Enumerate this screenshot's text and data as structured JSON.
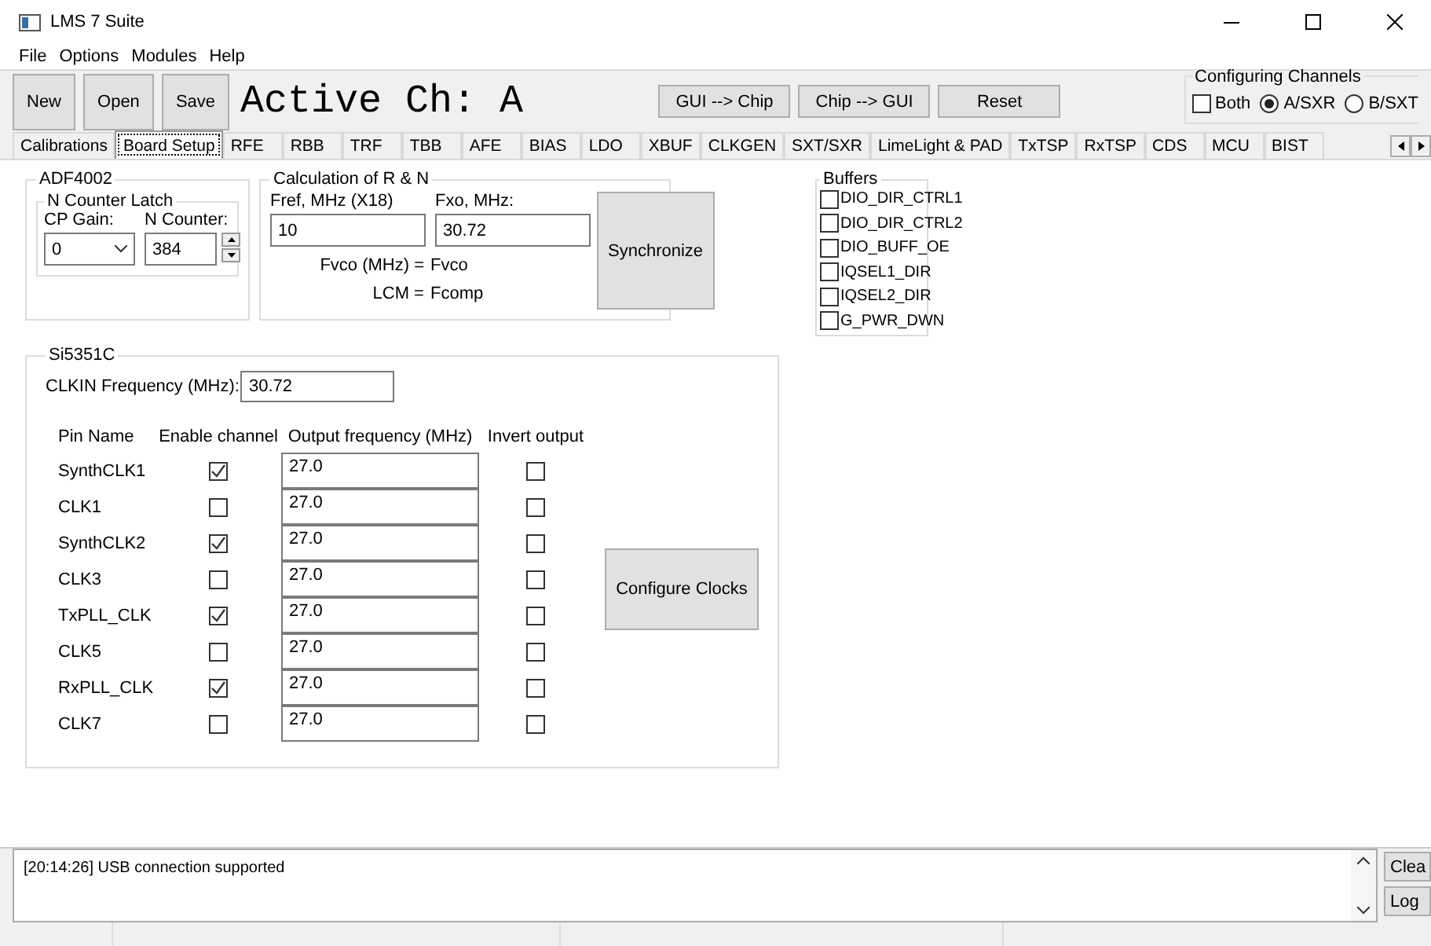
{
  "window": {
    "title": "LMS 7 Suite"
  },
  "menu": [
    "File",
    "Options",
    "Modules",
    "Help"
  ],
  "toolbar": {
    "buttons": [
      "New",
      "Open",
      "Save"
    ],
    "active_channel": "Active Ch: A",
    "actions": [
      "GUI --> Chip",
      "Chip --> GUI",
      "Reset"
    ],
    "channels": {
      "title": "Configuring Channels",
      "both": {
        "label": "Both",
        "checked": false
      },
      "options": [
        {
          "label": "A/SXR",
          "selected": true
        },
        {
          "label": "B/SXT",
          "selected": false
        }
      ]
    }
  },
  "tabs": [
    {
      "label": "Calibrations",
      "selected": false
    },
    {
      "label": "Board Setup",
      "selected": true
    },
    {
      "label": "RFE",
      "selected": false
    },
    {
      "label": "RBB",
      "selected": false
    },
    {
      "label": "TRF",
      "selected": false
    },
    {
      "label": "TBB",
      "selected": false
    },
    {
      "label": "AFE",
      "selected": false
    },
    {
      "label": "BIAS",
      "selected": false
    },
    {
      "label": "LDO",
      "selected": false
    },
    {
      "label": "XBUF",
      "selected": false
    },
    {
      "label": "CLKGEN",
      "selected": false
    },
    {
      "label": "SXT/SXR",
      "selected": false
    },
    {
      "label": "LimeLight & PAD",
      "selected": false
    },
    {
      "label": "TxTSP",
      "selected": false
    },
    {
      "label": "RxTSP",
      "selected": false
    },
    {
      "label": "CDS",
      "selected": false
    },
    {
      "label": "MCU",
      "selected": false
    },
    {
      "label": "BIST",
      "selected": false
    }
  ],
  "adf4002": {
    "title": "ADF4002",
    "latch_title": "N Counter Latch",
    "cp_gain_label": "CP Gain:",
    "cp_gain": "0",
    "n_counter_label": "N Counter:",
    "n_counter": "384"
  },
  "calc": {
    "title": "Calculation of R & N",
    "fref_label": "Fref, MHz (X18)",
    "fref": "10",
    "fxo_label": "Fxo, MHz:",
    "fxo": "30.72",
    "fvco_label": "Fvco (MHz) =",
    "fvco": "Fvco",
    "lcm_label": "LCM =",
    "lcm": "Fcomp",
    "button": "Synchronize"
  },
  "buffers": {
    "title": "Buffers",
    "items": [
      {
        "label": "DIO_DIR_CTRL1",
        "checked": false
      },
      {
        "label": "DIO_DIR_CTRL2",
        "checked": false
      },
      {
        "label": "DIO_BUFF_OE",
        "checked": false
      },
      {
        "label": "IQSEL1_DIR",
        "checked": false
      },
      {
        "label": "IQSEL2_DIR",
        "checked": false
      },
      {
        "label": "G_PWR_DWN",
        "checked": false
      }
    ]
  },
  "si5351c": {
    "title": "Si5351C",
    "clkin_label": "CLKIN Frequency (MHz):",
    "clkin": "30.72",
    "columns": [
      "Pin Name",
      "Enable channel",
      "Output frequency (MHz)",
      "Invert output"
    ],
    "rows": [
      {
        "pin": "SynthCLK1",
        "enabled": true,
        "frequency": "27.0",
        "inverted": false
      },
      {
        "pin": "CLK1",
        "enabled": false,
        "frequency": "27.0",
        "inverted": false
      },
      {
        "pin": "SynthCLK2",
        "enabled": true,
        "frequency": "27.0",
        "inverted": false
      },
      {
        "pin": "CLK3",
        "enabled": false,
        "frequency": "27.0",
        "inverted": false
      },
      {
        "pin": "TxPLL_CLK",
        "enabled": true,
        "frequency": "27.0",
        "inverted": false
      },
      {
        "pin": "CLK5",
        "enabled": false,
        "frequency": "27.0",
        "inverted": false
      },
      {
        "pin": "RxPLL_CLK",
        "enabled": true,
        "frequency": "27.0",
        "inverted": false
      },
      {
        "pin": "CLK7",
        "enabled": false,
        "frequency": "27.0",
        "inverted": false
      }
    ],
    "button": "Configure Clocks"
  },
  "log": {
    "lines": [
      "[20:14:26] USB connection supported"
    ],
    "buttons": [
      "Clea",
      "Log"
    ]
  }
}
